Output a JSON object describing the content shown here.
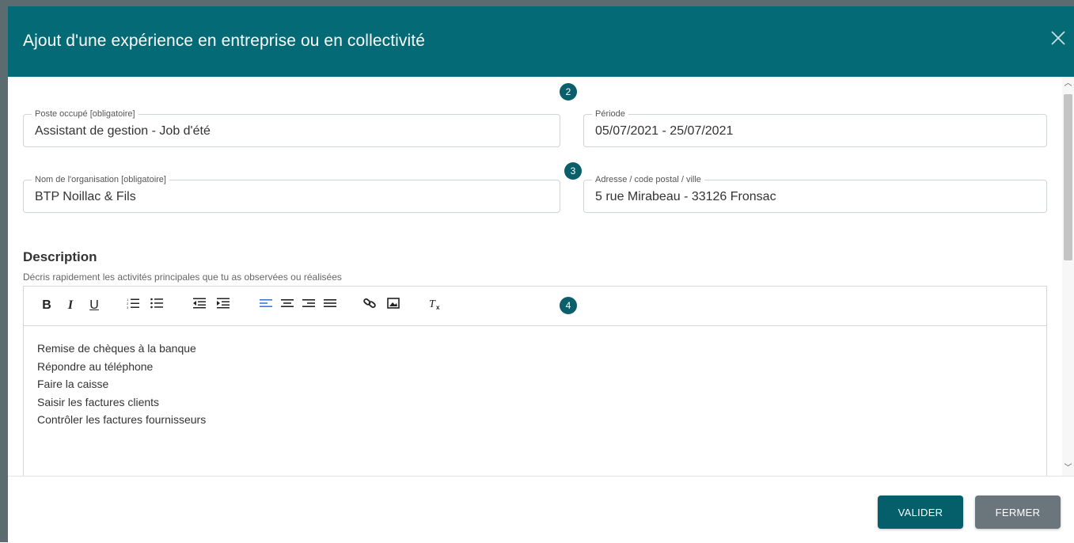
{
  "dialog": {
    "title": "Ajout d'une expérience en entreprise ou en collectivité",
    "close_icon": "close-icon"
  },
  "fields": {
    "poste": {
      "label": "Poste occupé [obligatoire]",
      "value": "Assistant de gestion - Job d'été"
    },
    "periode": {
      "label": "Période",
      "value": "05/07/2021 - 25/07/2021"
    },
    "organisation": {
      "label": "Nom de l'organisation [obligatoire]",
      "value": "BTP Noillac & Fils"
    },
    "adresse": {
      "label": "Adresse / code postal / ville",
      "value": "5 rue Mirabeau - 33126 Fronsac"
    }
  },
  "steps": [
    "2",
    "3",
    "4"
  ],
  "description": {
    "title": "Description",
    "help": "Décris rapidement les activités principales que tu as observées ou réalisées",
    "lines": [
      "Remise de chèques à la banque",
      "Répondre au téléphone",
      "Faire la caisse",
      "Saisir les factures clients",
      "Contrôler les factures fournisseurs"
    ]
  },
  "toolbar": {
    "bold": "B",
    "italic": "I",
    "underline": "U",
    "active_color": "#3a7bd5"
  },
  "buttons": {
    "valider": "VALIDER",
    "fermer": "FERMER"
  },
  "colors": {
    "header": "#036a76",
    "primary": "#045f6b",
    "secondary": "#6b757c"
  }
}
